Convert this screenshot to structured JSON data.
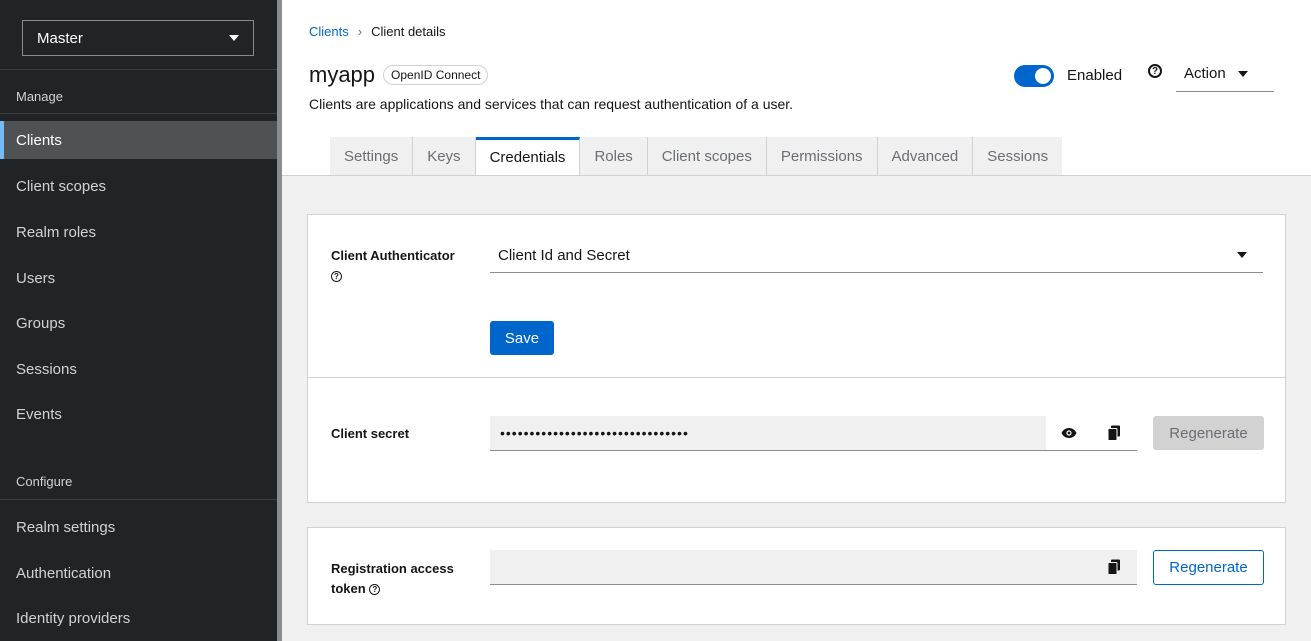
{
  "sidebar": {
    "realm": "Master",
    "manage_label": "Manage",
    "configure_label": "Configure",
    "manage_items": [
      {
        "label": "Clients"
      },
      {
        "label": "Client scopes"
      },
      {
        "label": "Realm roles"
      },
      {
        "label": "Users"
      },
      {
        "label": "Groups"
      },
      {
        "label": "Sessions"
      },
      {
        "label": "Events"
      }
    ],
    "configure_items": [
      {
        "label": "Realm settings"
      },
      {
        "label": "Authentication"
      },
      {
        "label": "Identity providers"
      }
    ]
  },
  "breadcrumb": {
    "link": "Clients",
    "current": "Client details"
  },
  "header": {
    "title": "myapp",
    "badge": "OpenID Connect",
    "subtitle": "Clients are applications and services that can request authentication of a user.",
    "enabled_label": "Enabled",
    "action_label": "Action"
  },
  "tabs": [
    {
      "label": "Settings"
    },
    {
      "label": "Keys"
    },
    {
      "label": "Credentials"
    },
    {
      "label": "Roles"
    },
    {
      "label": "Client scopes"
    },
    {
      "label": "Permissions"
    },
    {
      "label": "Advanced"
    },
    {
      "label": "Sessions"
    }
  ],
  "credentials": {
    "authenticator_label": "Client Authenticator",
    "authenticator_value": "Client Id and Secret",
    "save_label": "Save",
    "secret_label": "Client secret",
    "secret_value": "••••••••••••••••••••••••••••••••",
    "regenerate_label": "Regenerate",
    "registration_label_1": "Registration access",
    "registration_label_2": "token",
    "registration_value": "",
    "regenerate2_label": "Regenerate"
  },
  "colors": {
    "accent": "#0066cc",
    "sidebar_bg": "#212427",
    "active_nav": "#4f5255"
  }
}
